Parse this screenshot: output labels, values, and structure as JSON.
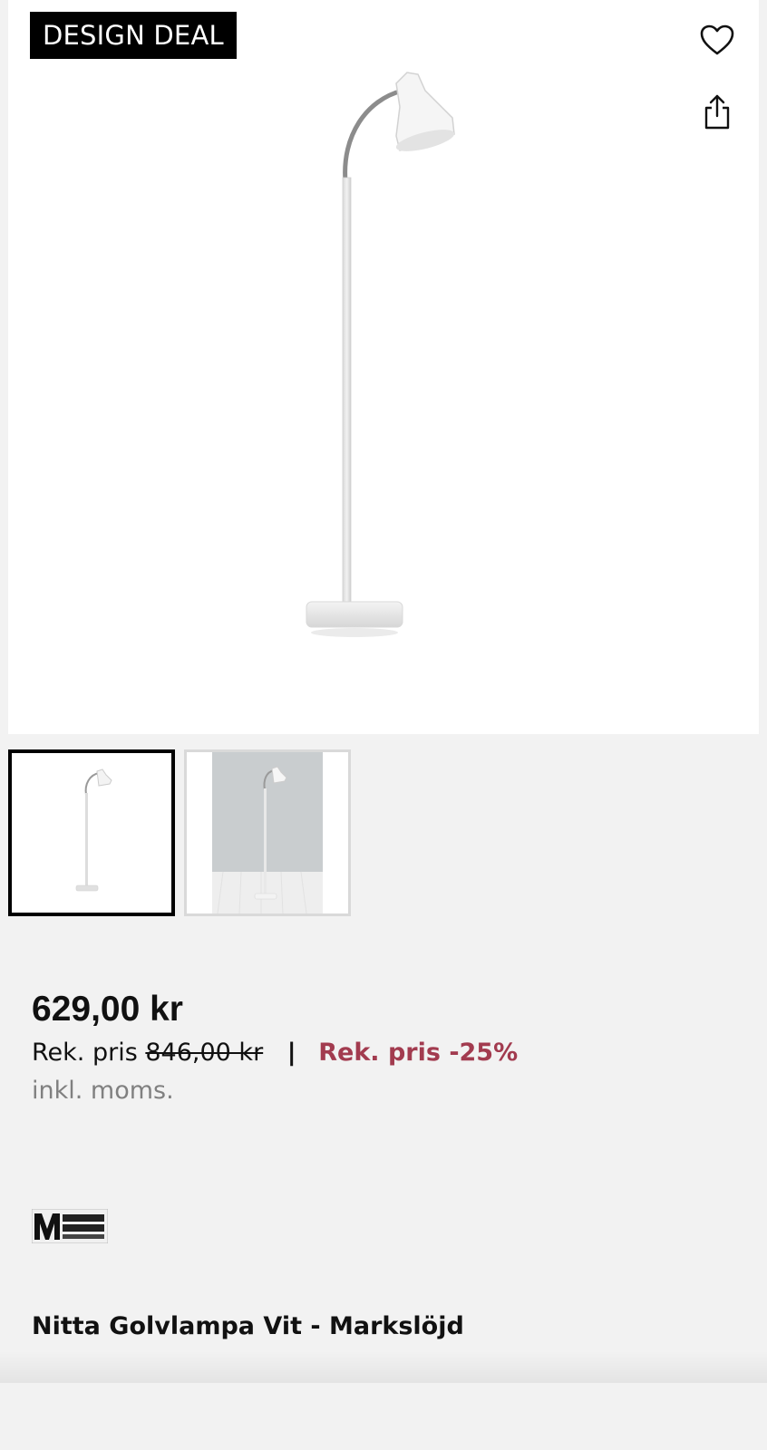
{
  "gallery": {
    "badge": "DESIGN DEAL",
    "favorite_icon": "heart-outline-icon",
    "share_icon": "share-icon",
    "main_image": "white-floor-lamp",
    "thumbnails": [
      {
        "image": "white-floor-lamp",
        "selected": true
      },
      {
        "image": "floor-lamp-room-scene",
        "selected": false
      }
    ]
  },
  "pricing": {
    "price": "629,00 kr",
    "rek_label": "Rek. pris",
    "original_price": "846,00 kr",
    "separator": "|",
    "discount": "Rek. pris -25%",
    "vat_note": "inkl. moms.",
    "discount_color": "#a23b4f"
  },
  "brand": {
    "logo_text": "MARKSLÖJD SWEDEN"
  },
  "product": {
    "title": "Nitta Golvlampa Vit - Markslöjd"
  }
}
